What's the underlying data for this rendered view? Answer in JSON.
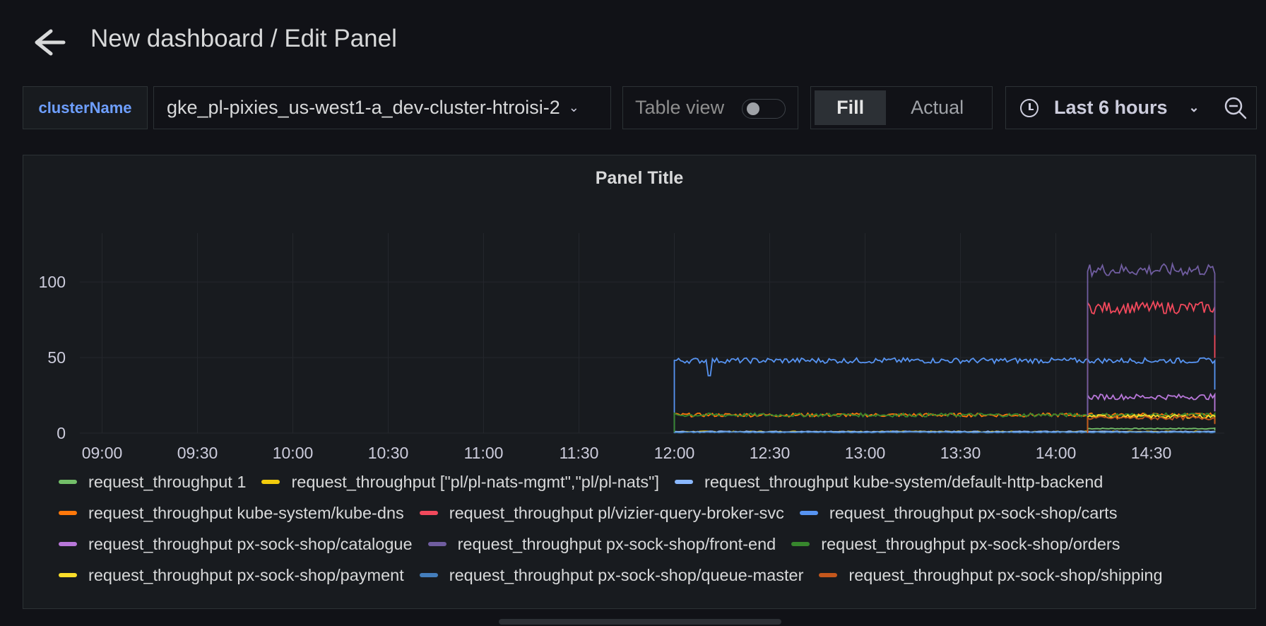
{
  "header": {
    "back_icon": "arrow-left-icon",
    "title": "New dashboard / Edit Panel"
  },
  "toolbar": {
    "variable_label": "clusterName",
    "variable_value": "gke_pl-pixies_us-west1-a_dev-cluster-htroisi-2",
    "table_view_label": "Table view",
    "table_view_on": false,
    "fill_label": "Fill",
    "actual_label": "Actual",
    "time_range_label": "Last 6 hours",
    "zoom_icon": "zoom-out-icon"
  },
  "panel": {
    "title": "Panel Title"
  },
  "chart_data": {
    "type": "line",
    "title": "Panel Title",
    "x_ticks": [
      "09:00",
      "09:30",
      "10:00",
      "10:30",
      "11:00",
      "11:30",
      "12:00",
      "12:30",
      "13:00",
      "13:30",
      "14:00",
      "14:30"
    ],
    "y_ticks": [
      0,
      50,
      100
    ],
    "ylim": [
      0,
      130
    ],
    "xlim": [
      "08:53",
      "14:53"
    ],
    "grid": true,
    "legend_placement": "bottom",
    "series": [
      {
        "name": "request_throughput 1",
        "color": "#73bf69",
        "start": "14:10",
        "end": "14:50",
        "value": 3
      },
      {
        "name": "request_throughput [\"pl/pl-nats-mgmt\",\"pl/pl-nats\"]",
        "color": "#f2cc0c",
        "start": "12:00",
        "end": "14:50",
        "value": 1
      },
      {
        "name": "request_throughput kube-system/default-http-backend",
        "color": "#8ab8ff",
        "start": "12:00",
        "end": "14:50",
        "value": 1
      },
      {
        "name": "request_throughput kube-system/kube-dns",
        "color": "#ff780a",
        "start": "12:00",
        "end": "14:50",
        "value": 12
      },
      {
        "name": "request_throughput pl/vizier-query-broker-svc",
        "color": "#f2495c",
        "start": "14:10",
        "end": "14:50",
        "value": 83
      },
      {
        "name": "request_throughput px-sock-shop/carts",
        "color": "#5794f2",
        "start": "12:00",
        "end": "14:50",
        "value": 48
      },
      {
        "name": "request_throughput px-sock-shop/catalogue",
        "color": "#b877d9",
        "start": "14:10",
        "end": "14:50",
        "value": 24
      },
      {
        "name": "request_throughput px-sock-shop/front-end",
        "color": "#705da0",
        "start": "14:10",
        "end": "14:50",
        "value": 108
      },
      {
        "name": "request_throughput px-sock-shop/orders",
        "color": "#37872d",
        "start": "12:00",
        "end": "14:50",
        "value": 12
      },
      {
        "name": "request_throughput px-sock-shop/payment",
        "color": "#fade2a",
        "start": "14:10",
        "end": "14:50",
        "value": 11
      },
      {
        "name": "request_throughput px-sock-shop/queue-master",
        "color": "#447ebc",
        "start": "12:00",
        "end": "14:50",
        "value": 0.5
      },
      {
        "name": "request_throughput px-sock-shop/shipping",
        "color": "#c4571c",
        "start": "14:10",
        "end": "14:50",
        "value": 10
      }
    ]
  }
}
